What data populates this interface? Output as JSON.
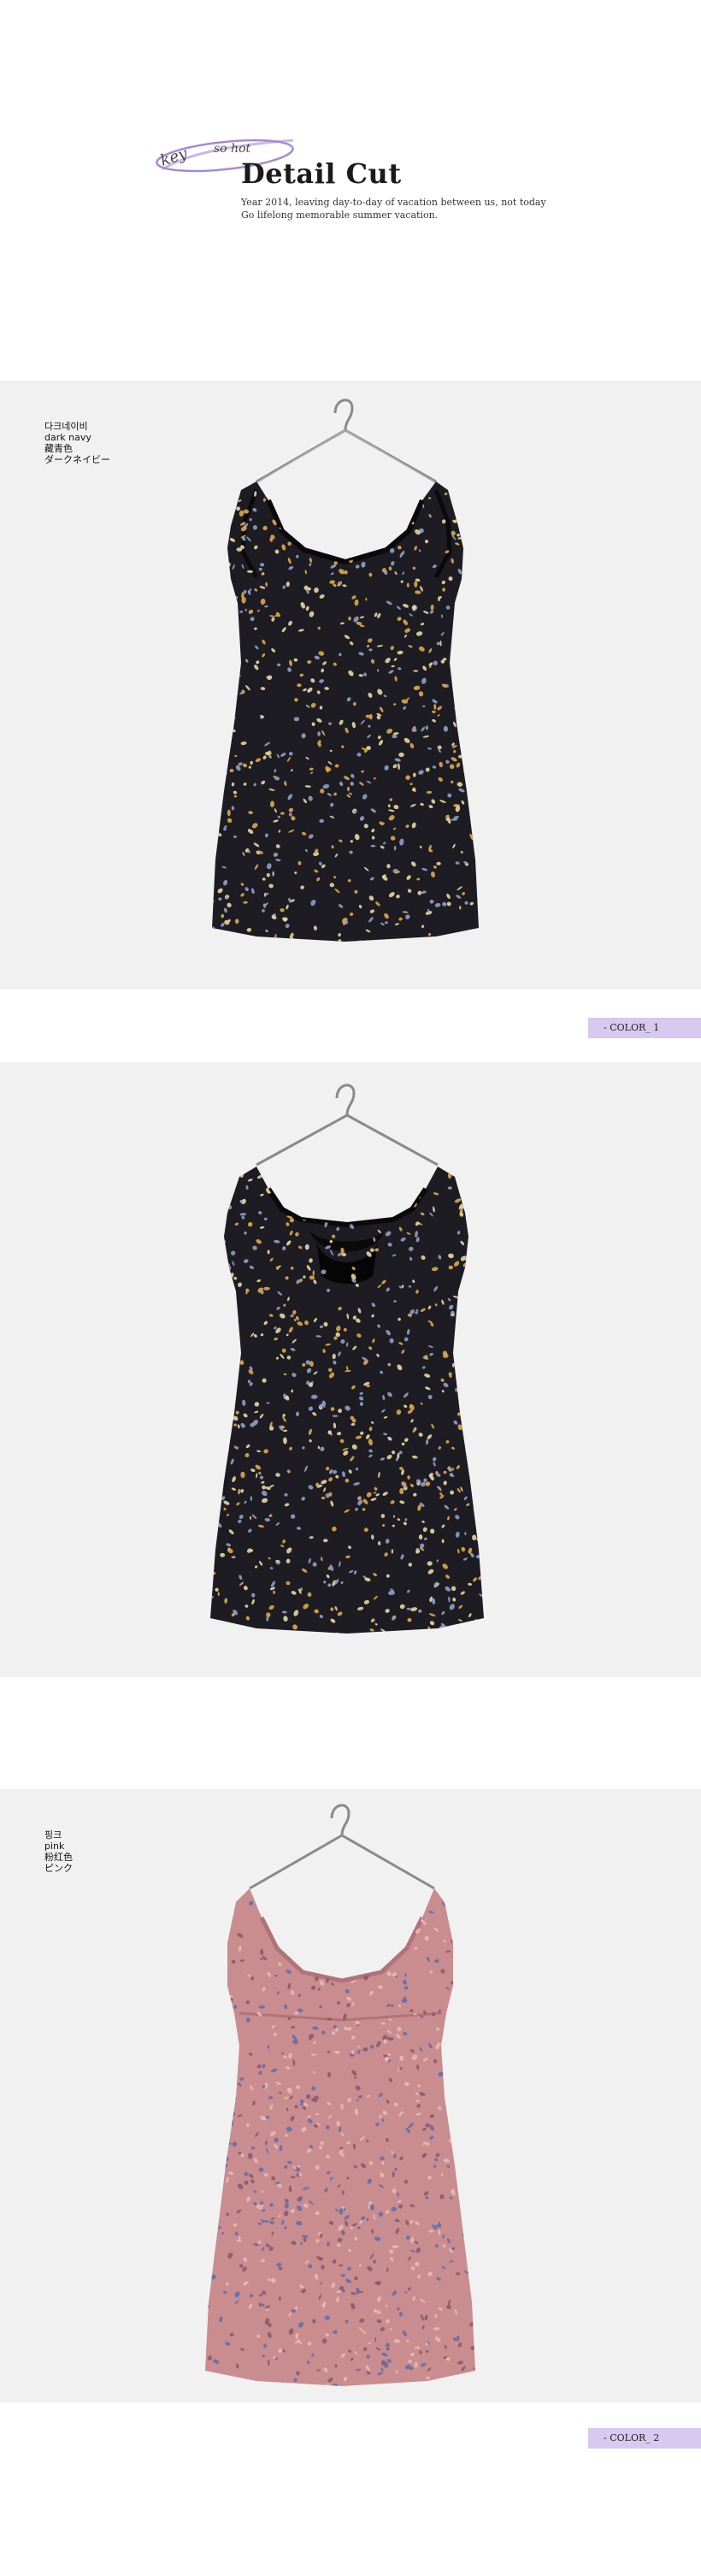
{
  "header": {
    "logo_text": "key so hot",
    "title": "Detail Cut",
    "desc_line1": "Year 2014, leaving day-to-day of vacation between us, not today",
    "desc_line2": "Go lifelong memorable summer vacation."
  },
  "sections": [
    {
      "label_lines": [
        "다크네이비",
        "dark navy",
        "藏青色",
        "ダークネイビー"
      ],
      "color_tag": "- COLOR_ 1",
      "dress_color": "#1d1c22",
      "print_colors": [
        "#e0a94a",
        "#8fa0c8",
        "#e8d7a2"
      ]
    },
    {
      "label_lines": [],
      "color_tag": "",
      "dress_color": "#1d1c22",
      "print_colors": [
        "#e0a94a",
        "#8fa0c8",
        "#e8d7a2"
      ]
    },
    {
      "label_lines": [
        "핑크",
        "pink",
        "粉红色",
        "ピンク"
      ],
      "color_tag": "- COLOR_ 2",
      "dress_color": "#c98c8f",
      "print_colors": [
        "#5f6fae",
        "#e8b8b0",
        "#8b5a6a"
      ]
    }
  ],
  "colors": {
    "panel_bg": "#f1f1f1",
    "tag_bg": "#d7c9f0",
    "logo_purple": "#a58ad6"
  }
}
